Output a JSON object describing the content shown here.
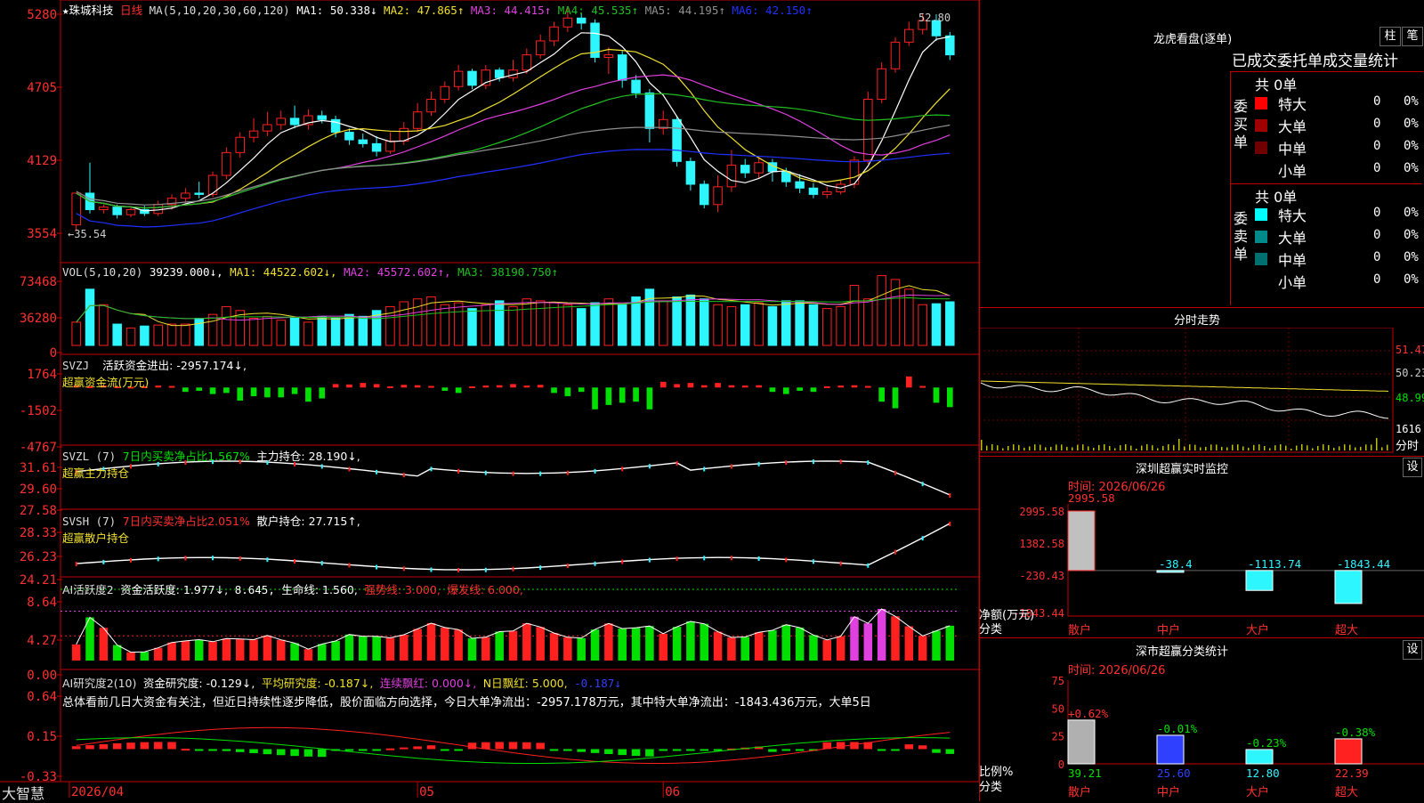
{
  "colors": {
    "up": "#ff2020",
    "down": "#2ef6ff",
    "ma1": "#ffffff",
    "ma2": "#f0e030",
    "ma3": "#e040e0",
    "ma4": "#20c020",
    "ma5": "#909090",
    "ma6": "#2030ff",
    "axis": "#c00000",
    "green": "#00e000"
  },
  "kline": {
    "stock_name": "珠城科技",
    "period": "日线",
    "ma_label": "MA(5,10,20,30,60,120)",
    "ma_values": [
      {
        "name": "MA1:",
        "value": "50.338↓"
      },
      {
        "name": "MA2:",
        "value": "47.865↑"
      },
      {
        "name": "MA3:",
        "value": "44.415↑"
      },
      {
        "name": "MA4:",
        "value": "45.535↑"
      },
      {
        "name": "MA5:",
        "value": "44.195↑"
      },
      {
        "name": "MA6:",
        "value": "42.150↑"
      }
    ],
    "y_ticks": [
      "5280",
      "4705",
      "4129",
      "3554"
    ],
    "y_tick_values": [
      52.8,
      47.05,
      41.29,
      35.54
    ],
    "high_label": "52.80",
    "low_label": "35.54",
    "low_arrow": "←"
  },
  "chart_data": {
    "type": "candlestick",
    "x_labels": [
      "2026/04",
      "05",
      "06"
    ],
    "x_label_idx": [
      0,
      25,
      43
    ],
    "ylim": [
      35.54,
      52.8
    ],
    "candles": [
      [
        36.2,
        38.7,
        37.6,
        35.7
      ],
      [
        38.7,
        37.4,
        41.1,
        37.1
      ],
      [
        37.4,
        37.6,
        37.8,
        37.1
      ],
      [
        37.6,
        37.0,
        37.8,
        36.7
      ],
      [
        37.0,
        37.4,
        37.7,
        36.8
      ],
      [
        37.4,
        37.1,
        37.7,
        36.9
      ],
      [
        37.1,
        37.8,
        38.1,
        36.9
      ],
      [
        37.8,
        38.3,
        38.6,
        37.4
      ],
      [
        38.3,
        38.7,
        39.1,
        38.0
      ],
      [
        38.7,
        38.6,
        39.6,
        38.3
      ],
      [
        38.6,
        40.1,
        40.4,
        38.4
      ],
      [
        40.1,
        41.9,
        42.3,
        39.8
      ],
      [
        41.9,
        43.1,
        43.5,
        41.5
      ],
      [
        43.1,
        43.6,
        44.6,
        42.7
      ],
      [
        43.6,
        44.1,
        45.1,
        43.2
      ],
      [
        44.1,
        44.6,
        45.2,
        43.7
      ],
      [
        44.6,
        44.1,
        45.6,
        43.8
      ],
      [
        44.1,
        44.8,
        45.3,
        43.7
      ],
      [
        44.8,
        44.5,
        45.2,
        44.2
      ],
      [
        44.5,
        43.5,
        44.8,
        43.1
      ],
      [
        43.5,
        42.9,
        43.8,
        42.5
      ],
      [
        42.9,
        42.6,
        43.4,
        42.3
      ],
      [
        42.6,
        42.0,
        43.2,
        41.6
      ],
      [
        42.0,
        42.8,
        43.5,
        41.8
      ],
      [
        42.8,
        43.8,
        44.3,
        42.5
      ],
      [
        43.8,
        45.1,
        45.8,
        43.5
      ],
      [
        45.1,
        46.1,
        46.7,
        44.8
      ],
      [
        46.1,
        47.1,
        47.5,
        45.8
      ],
      [
        47.1,
        48.3,
        48.8,
        46.8
      ],
      [
        48.3,
        47.2,
        48.5,
        46.9
      ],
      [
        47.2,
        48.4,
        48.8,
        46.9
      ],
      [
        48.4,
        47.8,
        48.6,
        47.5
      ],
      [
        47.8,
        48.4,
        49.2,
        47.5
      ],
      [
        48.4,
        49.6,
        50.1,
        48.1
      ],
      [
        49.6,
        50.7,
        51.2,
        49.3
      ],
      [
        50.7,
        51.8,
        52.2,
        50.3
      ],
      [
        51.8,
        52.5,
        53.3,
        51.4
      ],
      [
        52.5,
        52.1,
        52.9,
        51.6
      ],
      [
        52.1,
        49.4,
        52.4,
        49.0
      ],
      [
        49.4,
        49.6,
        50.2,
        48.1
      ],
      [
        49.6,
        47.6,
        49.9,
        47.0
      ],
      [
        47.6,
        46.6,
        48.0,
        46.2
      ],
      [
        46.6,
        43.8,
        46.9,
        42.7
      ],
      [
        43.8,
        44.5,
        45.2,
        43.3
      ],
      [
        44.5,
        41.2,
        44.8,
        40.8
      ],
      [
        41.2,
        39.4,
        41.5,
        38.9
      ],
      [
        39.4,
        37.8,
        39.7,
        37.5
      ],
      [
        37.8,
        39.2,
        40.1,
        37.2
      ],
      [
        39.2,
        40.9,
        42.1,
        38.8
      ],
      [
        40.9,
        40.3,
        41.4,
        39.9
      ],
      [
        40.3,
        41.1,
        41.5,
        39.9
      ],
      [
        41.1,
        40.4,
        41.4,
        39.6
      ],
      [
        40.4,
        39.6,
        40.7,
        39.2
      ],
      [
        39.6,
        39.1,
        40.2,
        38.7
      ],
      [
        39.1,
        38.6,
        39.5,
        38.3
      ],
      [
        38.6,
        38.8,
        39.2,
        38.3
      ],
      [
        38.8,
        39.4,
        39.7,
        38.6
      ],
      [
        39.4,
        41.3,
        41.6,
        39.1
      ],
      [
        41.3,
        46.1,
        46.7,
        41.0
      ],
      [
        46.1,
        48.5,
        49.0,
        45.8
      ],
      [
        48.5,
        50.6,
        51.0,
        48.2
      ],
      [
        50.6,
        51.6,
        52.2,
        50.3
      ],
      [
        51.6,
        52.3,
        52.9,
        51.2
      ],
      [
        52.3,
        51.1,
        52.8,
        50.7
      ],
      [
        51.1,
        49.6,
        51.4,
        49.2
      ]
    ],
    "volume": [
      24000,
      58000,
      42000,
      22000,
      18000,
      20000,
      21000,
      22000,
      22000,
      28000,
      32000,
      40000,
      36000,
      28000,
      30000,
      26000,
      28000,
      24000,
      30000,
      28000,
      32000,
      30000,
      36000,
      40000,
      45000,
      48000,
      50000,
      42000,
      44000,
      38000,
      42000,
      46000,
      40000,
      48000,
      46000,
      44000,
      42000,
      38000,
      44000,
      48000,
      42000,
      50000,
      58000,
      46000,
      50000,
      52000,
      48000,
      42000,
      40000,
      42000,
      44000,
      40000,
      46000,
      46000,
      42000,
      38000,
      40000,
      62000,
      48000,
      72000,
      68000,
      58000,
      42000,
      43000,
      45000
    ],
    "vol_y_ticks": [
      "73468",
      "36280",
      "0"
    ],
    "svzj": [
      -500,
      -300,
      -500,
      -300,
      -200,
      -300,
      -500,
      -400,
      -400,
      -300,
      -600,
      -500,
      -1200,
      -800,
      -900,
      -900,
      -600,
      -1300,
      -1000,
      -900,
      -800,
      -1200,
      -900,
      -300,
      -700,
      -600,
      -400,
      -300,
      -500,
      -300,
      -500,
      -600,
      -900,
      -500,
      -700,
      -500,
      -800,
      -400,
      -2000,
      -1600,
      -1400,
      -1300,
      -2000,
      -1500,
      -900,
      -1200,
      -600,
      1200,
      600,
      500,
      600,
      400,
      -600,
      -300,
      -400,
      -300,
      -500,
      -600,
      -400,
      -1300,
      -1900,
      -2900,
      -400,
      -1400,
      -1800
    ],
    "svzj_sign": [
      1,
      1,
      1,
      1,
      1,
      1,
      1,
      1,
      0,
      0,
      0,
      0,
      0,
      0,
      0,
      0,
      0,
      0,
      0,
      1,
      1,
      1,
      1,
      1,
      1,
      1,
      1,
      0,
      0,
      1,
      1,
      1,
      1,
      1,
      1,
      0,
      0,
      0,
      0,
      0,
      0,
      0,
      0,
      1,
      1,
      1,
      1,
      1,
      1,
      1,
      1,
      0,
      0,
      0,
      0,
      1,
      1,
      1,
      1,
      0,
      0,
      1,
      1,
      0,
      0
    ],
    "svzj_y_ticks": [
      "1764",
      "-1502",
      "-4767"
    ],
    "svzl_y_ticks": [
      "31.61",
      "29.60",
      "27.58"
    ],
    "svsh_y_ticks": [
      "28.33",
      "26.23",
      "24.21"
    ],
    "ai_y_ticks": [
      "8.64",
      "4.27",
      "0.00"
    ],
    "ai2_y_ticks": [
      "0.64",
      "0.15",
      "-0.33"
    ]
  },
  "panels": {
    "vol": {
      "label": "VOL(5,10,20)",
      "value": "39239.000↓,",
      "ma1": "MA1: 44522.602↓,",
      "ma2": "MA2: 45572.602↑,",
      "ma3": "MA3: 38190.750↑"
    },
    "svzj": {
      "label": "SVZJ",
      "text": "活跃资金进出: -2957.174↓,",
      "sub": "超赢资金流(万元)"
    },
    "svzl": {
      "label": "SVZL (7)",
      "text": "7日内买卖净占比1.567%",
      "text2": "主力持仓: 28.190↓,",
      "sub": "超赢主力持仓"
    },
    "svsh": {
      "label": "SVSH (7)",
      "text": "7日内买卖净占比2.051%",
      "text2": "散户持仓: 27.715↑,",
      "sub": "超赢散户持仓"
    },
    "ai": {
      "label": "AI活跃度2",
      "t1": "资金活跃度: 1.977↓,",
      "t2": "8.645,",
      "t3": "生命线: 1.560,",
      "t4": "强势线: 3.000,",
      "t5": "爆发线: 6.000,"
    },
    "ai2": {
      "label": "AI研究度2(10)",
      "t1": "资金研究度: -0.129↓,",
      "t2": "平均研究度: -0.187↓,",
      "t3": "连续飘红: 0.000↓,",
      "t4": "N日飘红: 5.000,",
      "t5": "-0.187↓",
      "summary": "总体看前几日大资金有关注，但近日持续性逐步降低，股价面临方向选择，今日大单净流出：-2957.178万元，其中特大单净流出：-1843.436万元，大单5日"
    }
  },
  "footer": {
    "logo": "大智慧"
  },
  "right": {
    "dragon": {
      "title": "龙虎看盘(逐单)",
      "btn1": "柱",
      "btn2": "笔",
      "header": "已成交委托单成交量统计",
      "buy_label": "委买单",
      "sell_label": "委卖单",
      "buy_total": "共 0单",
      "sell_total": "共 0单",
      "buy_rows": [
        {
          "name": "特大",
          "count": "0",
          "pct": "0%",
          "color": "#ff0000"
        },
        {
          "name": "大单",
          "count": "0",
          "pct": "0%",
          "color": "#a00000"
        },
        {
          "name": "中单",
          "count": "0",
          "pct": "0%",
          "color": "#700000"
        },
        {
          "name": "小单",
          "count": "0",
          "pct": "0%",
          "color": ""
        }
      ],
      "sell_rows": [
        {
          "name": "特大",
          "count": "0",
          "pct": "0%",
          "color": "#00ffff"
        },
        {
          "name": "大单",
          "count": "0",
          "pct": "0%",
          "color": "#008b8b"
        },
        {
          "name": "中单",
          "count": "0",
          "pct": "0%",
          "color": "#006f6f"
        },
        {
          "name": "小单",
          "count": "0",
          "pct": "0%",
          "color": ""
        }
      ]
    },
    "intraday": {
      "title": "分时走势",
      "prices": [
        "51.47",
        "50.23",
        "48.99"
      ],
      "volume_label": "1616",
      "unit": "分时"
    },
    "sz_monitor": {
      "title": "深圳超赢实时监控",
      "settings": "设",
      "time": "时间: 2026/06/26",
      "y_ticks": [
        "2995.58",
        "1382.58",
        "-230.43",
        "-1843.44"
      ],
      "ylabel": "净额(万元)",
      "xlabel": "分类",
      "bars": [
        {
          "cat": "散户",
          "value": 2995.58,
          "label": "2995.58"
        },
        {
          "cat": "中户",
          "value": -38.4,
          "label": "-38.4"
        },
        {
          "cat": "大户",
          "value": -1113.74,
          "label": "-1113.74"
        },
        {
          "cat": "超大",
          "value": -1843.44,
          "label": "-1843.44"
        }
      ]
    },
    "sz_stats": {
      "title": "深市超赢分类统计",
      "settings": "设",
      "time": "时间: 2026/06/26",
      "y_ticks": [
        "75",
        "50",
        "25",
        "0"
      ],
      "ylabel": "比例%",
      "xlabel": "分类",
      "bars": [
        {
          "cat": "散户",
          "value": 39.21,
          "pct": "+0.62%",
          "color": "#b0b0b0"
        },
        {
          "cat": "中户",
          "value": 25.6,
          "pct": "-0.01%",
          "color": "#3040ff"
        },
        {
          "cat": "大户",
          "value": 12.8,
          "pct": "-0.23%",
          "color": "#2ef6ff"
        },
        {
          "cat": "超大",
          "value": 22.39,
          "pct": "-0.38%",
          "color": "#ff2020"
        }
      ],
      "labels": [
        "39.21",
        "25.60",
        "12.80",
        "22.39"
      ]
    }
  }
}
